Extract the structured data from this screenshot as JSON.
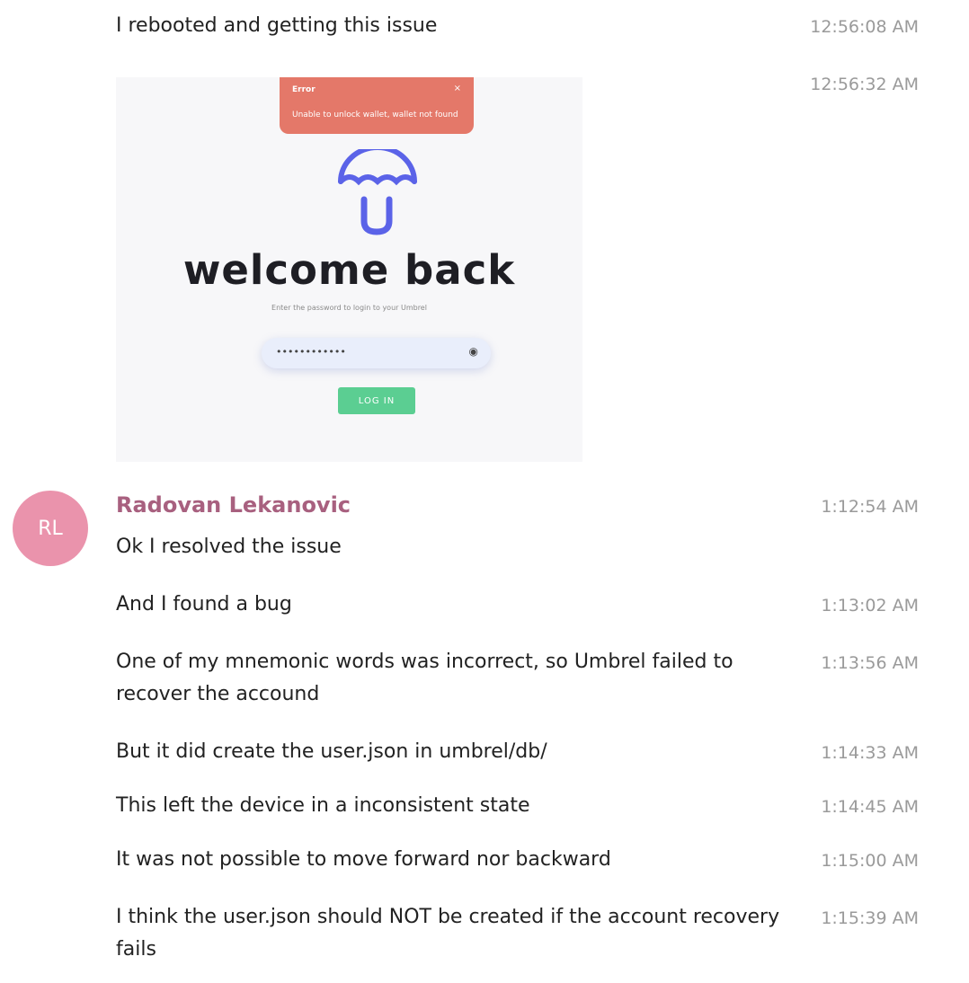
{
  "messages": [
    {
      "text": "I rebooted and getting this issue",
      "time": "12:56:08 AM"
    },
    {
      "time": "12:56:32 AM"
    }
  ],
  "screenshot": {
    "error_title": "Error",
    "error_close": "×",
    "error_message": "Unable to unlock wallet, wallet not found",
    "heading": "welcome back",
    "subtitle": "Enter the password to login to your Umbrel",
    "password_value": "••••••••••••",
    "login_label": "LOG IN"
  },
  "sender": {
    "initials": "RL",
    "name": "Radovan Lekanovic",
    "name_color": "#a8607f",
    "avatar_color": "#ea93ac"
  },
  "thread": [
    {
      "text": "Ok I resolved the issue",
      "time": "1:12:54 AM"
    },
    {
      "text": "And I found a bug",
      "time": "1:13:02 AM"
    },
    {
      "line1": "One of my mnemonic words was incorrect, so Umbrel failed to",
      "line2": "recover the accound",
      "time": "1:13:56 AM"
    },
    {
      "text": "But it did create the user.json in umbrel/db/",
      "time": "1:14:33 AM"
    },
    {
      "text": "This left the device in a inconsistent state",
      "time": "1:14:45 AM"
    },
    {
      "text": "It was not possible to move forward nor backward",
      "time": "1:15:00 AM"
    },
    {
      "line1": "I think the user.json should NOT be created if the account recovery",
      "line2": "fails",
      "time": "1:15:39 AM"
    }
  ]
}
